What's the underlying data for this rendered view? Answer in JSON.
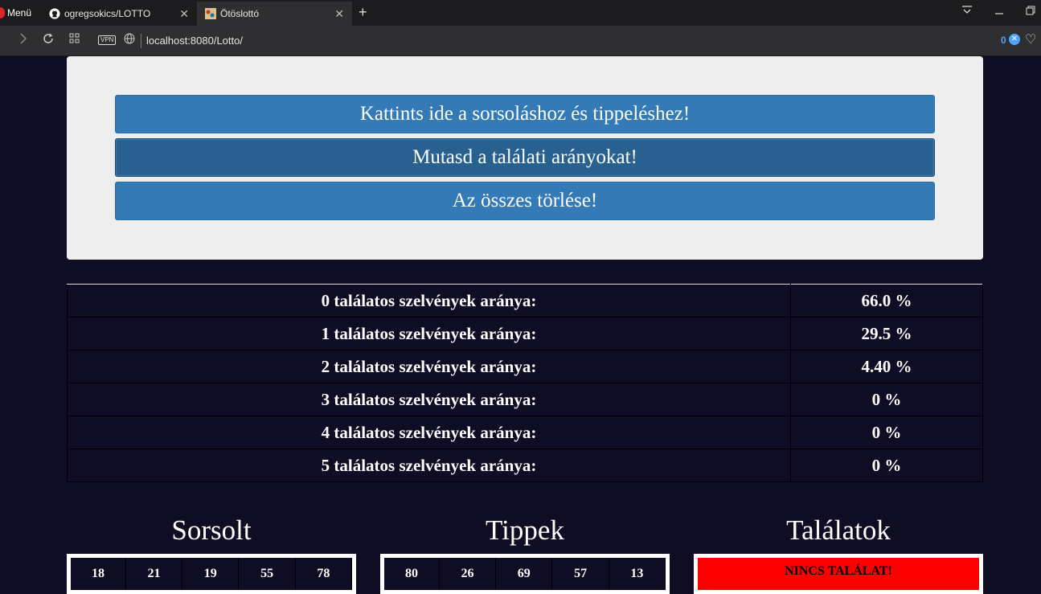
{
  "browser": {
    "menu_label": "Menü",
    "tabs": [
      {
        "title": "ogregsokics/LOTTO"
      },
      {
        "title": "Ötöslottó"
      }
    ],
    "new_tab": "+",
    "url": "localhost:8080/Lotto/",
    "vpn_label": "VPN",
    "tracker_count": "0"
  },
  "buttons": {
    "draw": "Kattints ide a sorsoláshoz és tippeléshez!",
    "ratios": "Mutasd a találati arányokat!",
    "clear": "Az összes törlése!"
  },
  "stats": [
    {
      "label": "0 találatos szelvények aránya:",
      "value": "66.0 %"
    },
    {
      "label": "1 találatos szelvények aránya:",
      "value": "29.5 %"
    },
    {
      "label": "2 találatos szelvények aránya:",
      "value": "4.40 %"
    },
    {
      "label": "3 találatos szelvények aránya:",
      "value": "0 %"
    },
    {
      "label": "4 találatos szelvények aránya:",
      "value": "0 %"
    },
    {
      "label": "5 találatos szelvények aránya:",
      "value": "0 %"
    }
  ],
  "columns": {
    "drawn_title": "Sorsolt",
    "tips_title": "Tippek",
    "matches_title": "Találatok",
    "drawn": [
      "18",
      "21",
      "19",
      "55",
      "78"
    ],
    "tips": [
      "80",
      "26",
      "69",
      "57",
      "13"
    ],
    "no_match": "NINCS TALÁLAT!"
  },
  "colors": {
    "page_bg": "#0e0d24",
    "button": "#337ab7",
    "button_active": "#286090",
    "no_match": "#ff0000"
  }
}
